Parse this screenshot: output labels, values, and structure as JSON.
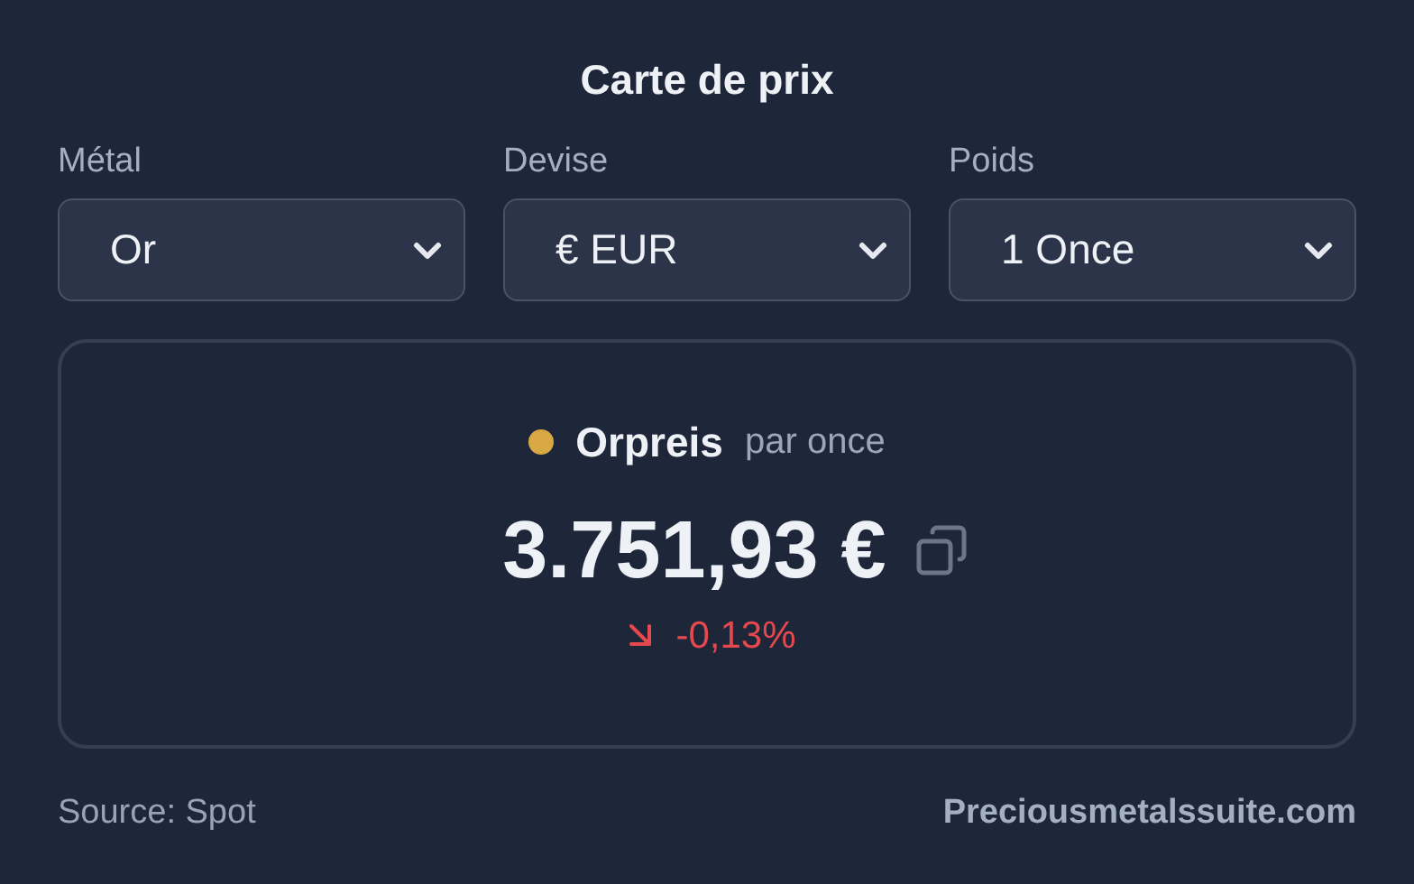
{
  "title": "Carte de prix",
  "selectors": [
    {
      "label": "Métal",
      "value": "Or"
    },
    {
      "label": "Devise",
      "value": "€ EUR"
    },
    {
      "label": "Poids",
      "value": "1 Once"
    }
  ],
  "price_card": {
    "metal": "Orpreis",
    "unit": "par once",
    "price": "3.751,93 €",
    "change": {
      "text": "-0,13%",
      "kind": "down"
    }
  },
  "footer": {
    "source": "Source: Spot",
    "link": "Preciousmetalssuite.com"
  }
}
